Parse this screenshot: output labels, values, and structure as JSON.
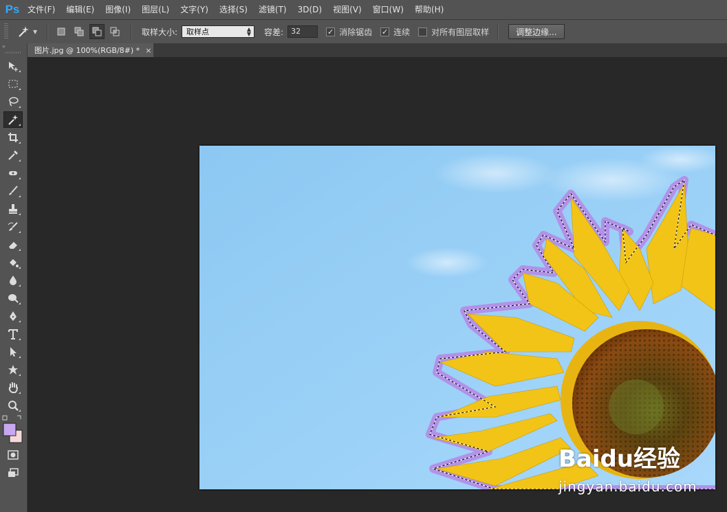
{
  "app": {
    "logo": "Ps"
  },
  "menu": [
    "文件(F)",
    "编辑(E)",
    "图像(I)",
    "图层(L)",
    "文字(Y)",
    "选择(S)",
    "滤镜(T)",
    "3D(D)",
    "视图(V)",
    "窗口(W)",
    "帮助(H)"
  ],
  "options": {
    "sample_size_label": "取样大小:",
    "sample_size_value": "取样点",
    "tolerance_label": "容差:",
    "tolerance_value": "32",
    "anti_alias_label": "消除锯齿",
    "anti_alias_checked": true,
    "contiguous_label": "连续",
    "contiguous_checked": true,
    "sample_all_layers_label": "对所有图层取样",
    "sample_all_layers_checked": false,
    "refine_edge_label": "调整边缘..."
  },
  "document": {
    "tab_title": "图片.jpg @ 100%(RGB/8#) *",
    "close": "×"
  },
  "tools": [
    "move-tool",
    "rectangular-marquee-tool",
    "lasso-tool",
    "magic-wand-tool",
    "crop-tool",
    "eyedropper-tool",
    "spot-healing-tool",
    "brush-tool",
    "clone-stamp-tool",
    "history-brush-tool",
    "eraser-tool",
    "paint-bucket-tool",
    "blur-tool",
    "dodge-tool",
    "pen-tool",
    "type-tool",
    "path-selection-tool",
    "custom-shape-tool",
    "hand-tool",
    "zoom-tool"
  ],
  "active_tool": "magic-wand-tool",
  "colors": {
    "foreground": "#c7a8f0",
    "background": "#f6d8d8",
    "ps_blue": "#31a8ff"
  },
  "watermark": {
    "logo": "Baidu经验",
    "url": "jingyan.baidu.com"
  }
}
